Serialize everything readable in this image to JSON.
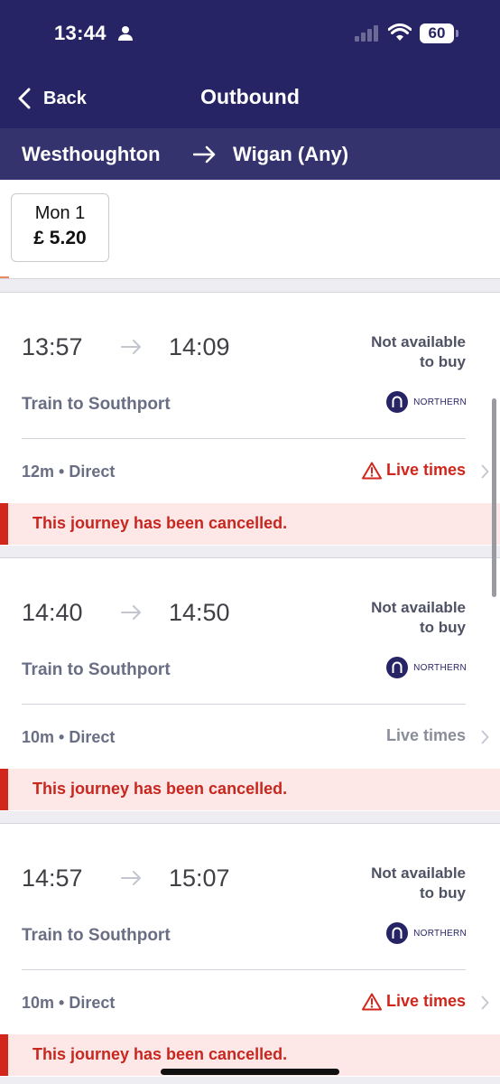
{
  "status_bar": {
    "time": "13:44",
    "battery": "60"
  },
  "nav": {
    "back_label": "Back",
    "title": "Outbound"
  },
  "route": {
    "origin": "Westhoughton",
    "destination": "Wigan (Any)"
  },
  "dates": [
    {
      "day": "Mon 1",
      "price": "£ 5.20"
    }
  ],
  "journeys": [
    {
      "depart": "13:57",
      "arrive": "14:09",
      "availability_line1": "Not available",
      "availability_line2": "to buy",
      "service": "Train to Southport",
      "operator": "NORTHERN",
      "duration": "12m • Direct",
      "live_times": "Live times",
      "live_alert": true,
      "cancel_message": "This journey has been cancelled."
    },
    {
      "depart": "14:40",
      "arrive": "14:50",
      "availability_line1": "Not available",
      "availability_line2": "to buy",
      "service": "Train to Southport",
      "operator": "NORTHERN",
      "duration": "10m • Direct",
      "live_times": "Live times",
      "live_alert": false,
      "cancel_message": "This journey has been cancelled."
    },
    {
      "depart": "14:57",
      "arrive": "15:07",
      "availability_line1": "Not available",
      "availability_line2": "to buy",
      "service": "Train to Southport",
      "operator": "NORTHERN",
      "duration": "10m • Direct",
      "live_times": "Live times",
      "live_alert": true,
      "cancel_message": "This journey has been cancelled."
    }
  ],
  "icons": {
    "person": "person-icon",
    "signal": "cellular-signal-icon",
    "wifi": "wifi-icon",
    "back": "chevron-left-icon",
    "route_arrow": "arrow-right-icon",
    "operator_logo": "northern-logo-icon",
    "warning": "warning-triangle-icon",
    "row_chevron": "chevron-right-icon"
  },
  "colors": {
    "header": "#272465",
    "route_bar": "#35336e",
    "alert_red": "#d2261c",
    "cancel_bg": "#fde7e7"
  }
}
